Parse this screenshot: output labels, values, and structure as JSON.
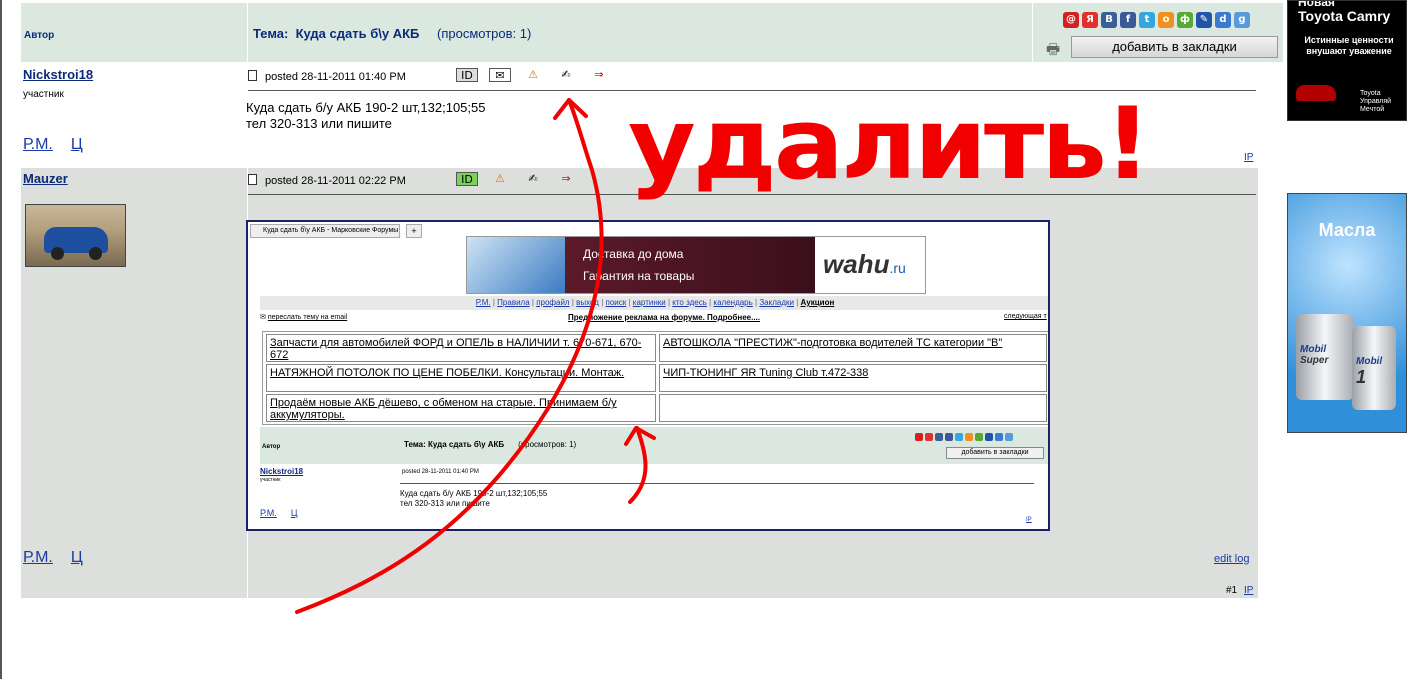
{
  "header": {
    "author_col": "Автор",
    "topic_label": "Тема:",
    "topic_title": "Куда сдать б\\у АКБ",
    "views": "(просмотров: 1)",
    "bookmark_button": "добавить в закладки"
  },
  "share_icons": [
    {
      "name": "mail-icon",
      "color": "#d32020",
      "glyph": "@"
    },
    {
      "name": "yandex-icon",
      "color": "#e03030",
      "glyph": "Я"
    },
    {
      "name": "vk-icon",
      "color": "#3b5f96",
      "glyph": "В"
    },
    {
      "name": "facebook-icon",
      "color": "#3b5998",
      "glyph": "f"
    },
    {
      "name": "twitter-icon",
      "color": "#35a6e0",
      "glyph": "t"
    },
    {
      "name": "odnoklassniki-icon",
      "color": "#f09020",
      "glyph": "о"
    },
    {
      "name": "friends-icon",
      "color": "#55aa33",
      "glyph": "ф"
    },
    {
      "name": "pencil-icon",
      "color": "#2255aa",
      "glyph": "✎"
    },
    {
      "name": "delicious-icon",
      "color": "#3a7ad0",
      "glyph": "d"
    },
    {
      "name": "google-icon",
      "color": "#5a9ad8",
      "glyph": "g"
    }
  ],
  "post1": {
    "username": "Nickstroi18",
    "role": "участник",
    "posted": "posted 28-11-2011 01:40 PM",
    "text_line1": "Куда сдать б/у АКБ 190-2 шт,132;105;55",
    "text_line2": "тел 320-313 или пишите",
    "pm": "Р.М.",
    "c": "Ц",
    "ip": "IP"
  },
  "post2": {
    "username": "Mauzer",
    "posted": "posted 28-11-2011 02:22 PM",
    "pm": "Р.М.",
    "c": "Ц",
    "edit_log": "edit log",
    "post_number": "#1",
    "ip": "IP"
  },
  "overlay_text": "удалить!",
  "embedded": {
    "tab_title": "Куда сдать б\\у АКБ - Марковские Форумы",
    "tab_plus": "+",
    "banner_line1": "Доставка до дома",
    "banner_line2": "Гарантия на товары",
    "banner_logo": "wahu",
    "banner_logo_suffix": ".ru",
    "nav": [
      "Р.М.",
      "Правила",
      "профайл",
      "выход",
      "поиск",
      "картинки",
      "кто здесь",
      "календарь",
      "Закладки"
    ],
    "nav_bold": "Аукцион",
    "send_email": "переслать тему на email",
    "ad_offer": "Предложение реклама на форуме. Подробнее....",
    "next_topic": "следующая т",
    "ads": [
      "Запчасти для автомобилей ФОРД и ОПЕЛЬ в НАЛИЧИИ т. 670-671, 670-672",
      "АВТОШКОЛА \"ПРЕСТИЖ\"-подготовка водителей ТС категории \"В\"",
      "НАТЯЖНОЙ ПОТОЛОК ПО ЦЕНЕ ПОБЕЛКИ. Консультации. Монтаж.",
      "ЧИП-ТЮНИНГ ЯR Tuning Club т.472-338",
      "Продаём новые АКБ дёшево, с обменом на старые. Принимаем б/у аккумуляторы."
    ],
    "hdr_author": "Автор",
    "hdr_topic": "Тема:  Куда сдать б\\у АКБ",
    "hdr_views": "(просмотров: 1)",
    "bookmark": "добавить в закладки",
    "username": "Nickstroi18",
    "role": "участник",
    "posted": "posted 28-11-2011 01:40 PM",
    "text_line1": "Куда сдать б/у АКБ 190-2 шт,132;105;55",
    "text_line2": "тел 320-313 или пишите",
    "pm": "Р.М.",
    "c": "Ц",
    "ip": "IP"
  },
  "ad_toyota": {
    "line1": "Новая",
    "line2": "Toyota Camry",
    "slogan": "Истинные ценности внушают уважение",
    "brand": "Toyota",
    "tagline": "Управляй Мечтой"
  },
  "ad_oil": {
    "title": "Масла",
    "brand": "Mobil",
    "product1": "Super",
    "product2": "1"
  },
  "colors": {
    "header_bg": "#dbe8e0",
    "post2_bg": "#dcdfdc",
    "link": "#1a3aa8",
    "overlay_red": "#f20000"
  }
}
